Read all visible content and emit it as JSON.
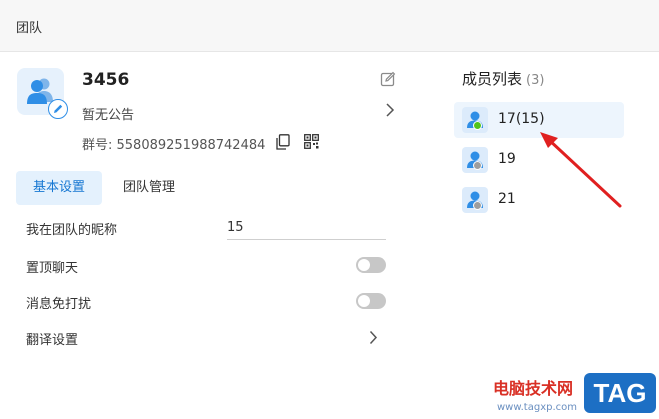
{
  "window": {
    "title": "团队"
  },
  "team": {
    "name": "3456",
    "notice": "暂无公告",
    "group_number": "群号: 558089251988742484"
  },
  "icons": {
    "avatar": "team-people-icon",
    "avatar_badge": "pencil-icon",
    "edit": "edit-icon",
    "notice": "chevron-right-icon",
    "copy": "copy-icon",
    "qr": "qr-code-icon"
  },
  "tabs": [
    {
      "label": "基本设置",
      "active": true
    },
    {
      "label": "团队管理",
      "active": false
    }
  ],
  "settings": {
    "nickname": {
      "label": "我在团队的昵称",
      "value": "15"
    },
    "pin_chat": {
      "label": "置顶聊天",
      "enabled": false
    },
    "mute": {
      "label": "消息免打扰",
      "enabled": false
    },
    "translate": {
      "label": "翻译设置"
    }
  },
  "members": {
    "title": "成员列表",
    "count": "(3)",
    "items": [
      {
        "name": "17(15)",
        "status": "online",
        "status_color": "#52c41a"
      },
      {
        "name": "19",
        "status": "offline",
        "status_color": "#9e9e9e"
      },
      {
        "name": "21",
        "status": "offline",
        "status_color": "#9e9e9e"
      }
    ]
  },
  "watermark": {
    "brand": "电脑技术网",
    "url": "www.tagxp.com",
    "tag": "TAG"
  },
  "colors": {
    "accent": "#1677d2",
    "tab_active_bg": "#e4f1fd",
    "annotation_arrow": "#e02020"
  }
}
